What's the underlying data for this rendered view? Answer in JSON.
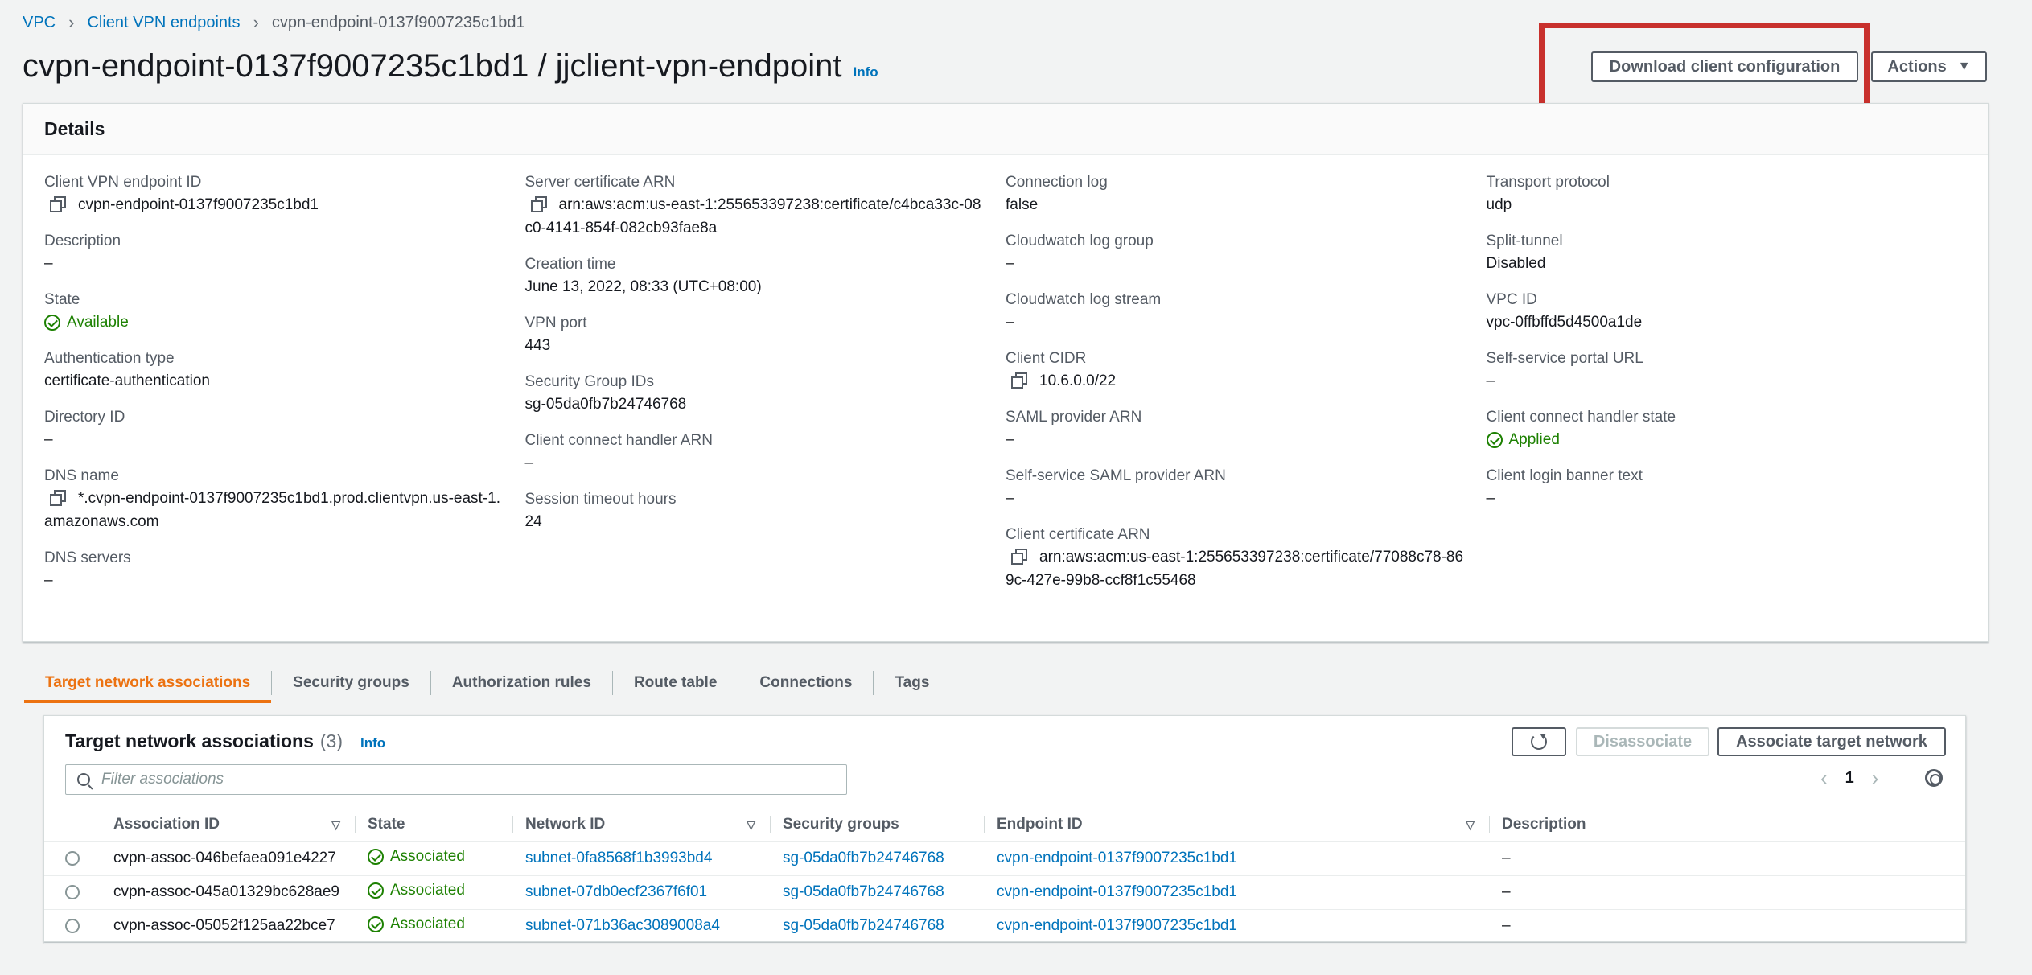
{
  "breadcrumb": {
    "items": [
      "VPC",
      "Client VPN endpoints"
    ],
    "current": "cvpn-endpoint-0137f9007235c1bd1"
  },
  "header": {
    "title": "cvpn-endpoint-0137f9007235c1bd1 / jjclient-vpn-endpoint",
    "info": "Info",
    "download_button": "Download client configuration",
    "actions_button": "Actions",
    "actions_caret": "▼"
  },
  "details": {
    "title": "Details",
    "col1": {
      "endpoint_id_label": "Client VPN endpoint ID",
      "endpoint_id_value": "cvpn-endpoint-0137f9007235c1bd1",
      "description_label": "Description",
      "description_value": "–",
      "state_label": "State",
      "state_value": "Available",
      "auth_type_label": "Authentication type",
      "auth_type_value": "certificate-authentication",
      "directory_id_label": "Directory ID",
      "directory_id_value": "–",
      "dns_name_label": "DNS name",
      "dns_name_value": "*.cvpn-endpoint-0137f9007235c1bd1.prod.clientvpn.us-east-1.amazonaws.com",
      "dns_servers_label": "DNS servers",
      "dns_servers_value": "–"
    },
    "col2": {
      "server_cert_label": "Server certificate ARN",
      "server_cert_value": "arn:aws:acm:us-east-1:255653397238:certificate/c4bca33c-08c0-4141-854f-082cb93fae8a",
      "creation_time_label": "Creation time",
      "creation_time_value": "June 13, 2022, 08:33 (UTC+08:00)",
      "vpn_port_label": "VPN port",
      "vpn_port_value": "443",
      "sg_ids_label": "Security Group IDs",
      "sg_ids_value": "sg-05da0fb7b24746768",
      "handler_arn_label": "Client connect handler ARN",
      "handler_arn_value": "–",
      "session_timeout_label": "Session timeout hours",
      "session_timeout_value": "24"
    },
    "col3": {
      "conn_log_label": "Connection log",
      "conn_log_value": "false",
      "cw_group_label": "Cloudwatch log group",
      "cw_group_value": "–",
      "cw_stream_label": "Cloudwatch log stream",
      "cw_stream_value": "–",
      "cidr_label": "Client CIDR",
      "cidr_value": "10.6.0.0/22",
      "saml_label": "SAML provider ARN",
      "saml_value": "–",
      "ss_saml_label": "Self-service SAML provider ARN",
      "ss_saml_value": "–",
      "client_cert_label": "Client certificate ARN",
      "client_cert_value": "arn:aws:acm:us-east-1:255653397238:certificate/77088c78-869c-427e-99b8-ccf8f1c55468"
    },
    "col4": {
      "transport_label": "Transport protocol",
      "transport_value": "udp",
      "split_label": "Split-tunnel",
      "split_value": "Disabled",
      "vpc_id_label": "VPC ID",
      "vpc_id_value": "vpc-0ffbffd5d4500a1de",
      "portal_label": "Self-service portal URL",
      "portal_value": "–",
      "handler_state_label": "Client connect handler state",
      "handler_state_value": "Applied",
      "banner_label": "Client login banner text",
      "banner_value": "–"
    }
  },
  "tabs": [
    "Target network associations",
    "Security groups",
    "Authorization rules",
    "Route table",
    "Connections",
    "Tags"
  ],
  "associations": {
    "title": "Target network associations",
    "count": "(3)",
    "info": "Info",
    "disassociate_button": "Disassociate",
    "associate_button": "Associate target network",
    "filter_placeholder": "Filter associations",
    "page": "1",
    "prev": "‹",
    "next": "›",
    "columns": [
      "Association ID",
      "State",
      "Network ID",
      "Security groups",
      "Endpoint ID",
      "Description"
    ],
    "sort_glyph": "▽",
    "rows": [
      {
        "id": "cvpn-assoc-046befaea091e4227",
        "state": "Associated",
        "network": "subnet-0fa8568f1b3993bd4",
        "sg": "sg-05da0fb7b24746768",
        "endpoint": "cvpn-endpoint-0137f9007235c1bd1",
        "description": "–"
      },
      {
        "id": "cvpn-assoc-045a01329bc628ae9",
        "state": "Associated",
        "network": "subnet-07db0ecf2367f6f01",
        "sg": "sg-05da0fb7b24746768",
        "endpoint": "cvpn-endpoint-0137f9007235c1bd1",
        "description": "–"
      },
      {
        "id": "cvpn-assoc-05052f125aa22bce7",
        "state": "Associated",
        "network": "subnet-071b36ac3089008a4",
        "sg": "sg-05da0fb7b24746768",
        "endpoint": "cvpn-endpoint-0137f9007235c1bd1",
        "description": "–"
      }
    ]
  },
  "colors": {
    "link": "#0073bb",
    "success": "#1d8102",
    "active_tab": "#ec7211",
    "highlight": "#c8302c"
  },
  "icons": [
    "chevron-right-icon",
    "copy-icon",
    "check-circle-icon",
    "caret-down-icon",
    "refresh-icon",
    "search-icon",
    "settings-gear-icon",
    "sort-icon"
  ]
}
